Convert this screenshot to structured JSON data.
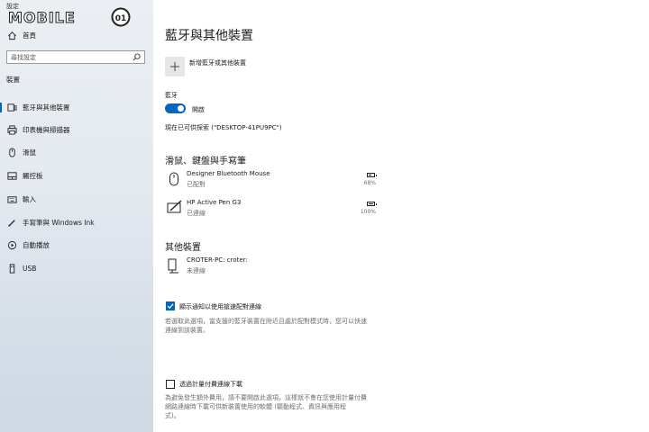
{
  "window": {
    "title": "設定"
  },
  "brand": {
    "logo_text": "MOBILE",
    "logo_tag": "01"
  },
  "sidebar": {
    "home_label": "首頁",
    "search_placeholder": "尋找設定",
    "section_label": "裝置",
    "items": [
      {
        "label": "藍牙與其他裝置",
        "icon": "bluetooth-devices-icon",
        "active": true
      },
      {
        "label": "印表機與掃描器",
        "icon": "printer-icon",
        "active": false
      },
      {
        "label": "滑鼠",
        "icon": "mouse-icon",
        "active": false
      },
      {
        "label": "觸控板",
        "icon": "touchpad-icon",
        "active": false
      },
      {
        "label": "輸入",
        "icon": "keyboard-icon",
        "active": false
      },
      {
        "label": "手寫筆與 Windows Ink",
        "icon": "pen-icon",
        "active": false
      },
      {
        "label": "自動播放",
        "icon": "autoplay-icon",
        "active": false
      },
      {
        "label": "USB",
        "icon": "usb-icon",
        "active": false
      }
    ]
  },
  "main": {
    "page_title": "藍牙與其他裝置",
    "add_device_label": "新增藍牙或其他裝置",
    "bluetooth": {
      "label": "藍牙",
      "toggle_state": "開啟",
      "toggle_on": true,
      "discoverable_text": "現在已可供探索 (\"DESKTOP-41PU9PC\")"
    },
    "mouse_section": {
      "title": "滑鼠、鍵盤與手寫筆",
      "devices": [
        {
          "name": "Designer Bluetooth Mouse",
          "status": "已配對",
          "battery": "68%",
          "battery_level": 0.68,
          "icon": "mouse-icon"
        },
        {
          "name": "HP Active Pen G3",
          "status": "已連線",
          "battery": "100%",
          "battery_level": 1.0,
          "icon": "pen-tablet-icon"
        }
      ]
    },
    "other_section": {
      "title": "其他裝置",
      "devices": [
        {
          "name": "CROTER-PC: croter:",
          "status": "未連線",
          "icon": "display-device-icon"
        }
      ]
    },
    "swift_pair": {
      "checked": true,
      "label": "顯示通知以使用搶速配對連線",
      "description_line1": "若選取此選項，當支援的藍牙裝置在附近且處於配對模式時，您可以快速",
      "description_line2": "連線到該裝置。"
    },
    "metered": {
      "checked": false,
      "label": "透過計量付費連線下載",
      "description_line1": "為避免發生額外費用，請不要開啟此選項，這樣就不會在您使用計量付費",
      "description_line2": "網路連線時下載可供新裝置使用的軟體 (驅動程式、資訊與應用程",
      "description_line3": "式)。"
    }
  },
  "colors": {
    "accent": "#0067c0",
    "toggle_on": "#0067c0"
  }
}
